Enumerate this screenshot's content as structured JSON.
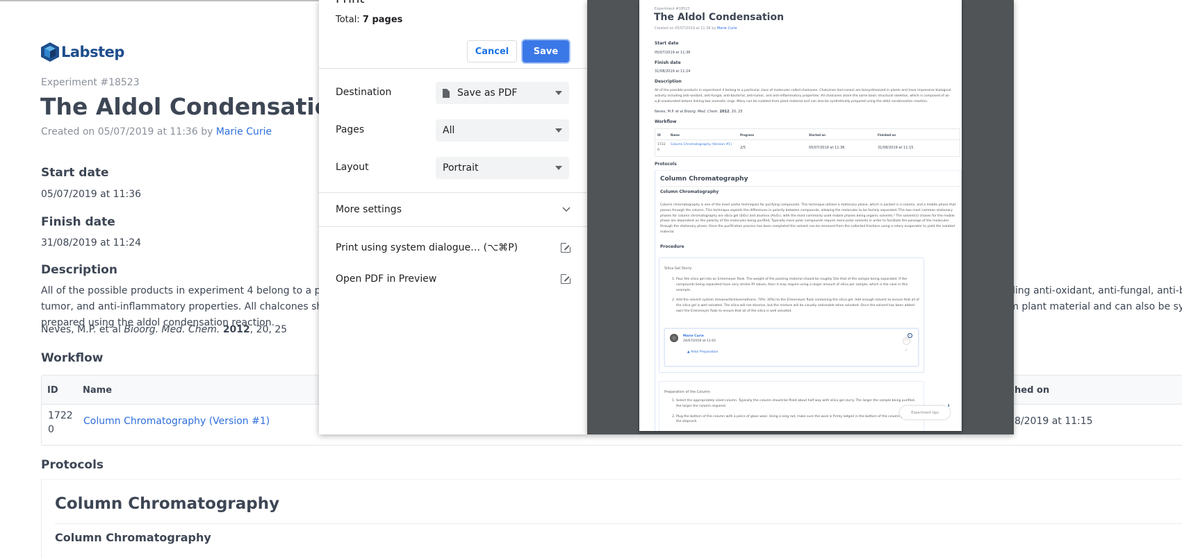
{
  "experiment": {
    "brand": "Labstep",
    "number": "Experiment #18523",
    "title": "The Aldol Condensation",
    "created_prefix": "Created on 05/07/2019 at 11:36 by",
    "author": "Marie Curie",
    "start_label": "Start date",
    "start_value": "05/07/2019 at 11:36",
    "finish_label": "Finish date",
    "finish_value": "31/08/2019 at 11:24",
    "description_label": "Description",
    "description": "All of the possible products in experiment 4 belong to a particular class of molecules called chalcones. Chalcones (kal-cones) are biosynthesized in plants and have impressive biological activity including anti-oxidant, anti-fungal, anti-bacterial, anti-tumor, and anti-inflammatory properties. All chalcones share the same basic structural skeleton, which is composed of an α,β-unsaturated ketone linking two aromatic rings. Many can be isolated from plant material and can also be synthetically prepared using the aldol condensation reaction.",
    "ref_authors": "Neves, M.P. et al",
    "ref_journal": "Bioorg. Med. Chem.",
    "ref_year": "2012",
    "ref_rest": ", 20, 25",
    "workflow_label": "Workflow",
    "workflow": {
      "columns": [
        "ID",
        "Name",
        "Progress",
        "Started on",
        "Finished on"
      ],
      "visible_finished_header": "hed on",
      "rows": [
        {
          "id": "1722 0",
          "name": "Column Chromatography (Version #1)",
          "progress": "2/5",
          "started": "05/07/2019 at 11:36",
          "finished": "31/08/2019 at 11:15",
          "visible_finished": "8/2019 at 11:15"
        }
      ]
    },
    "protocols_label": "Protocols",
    "protocol_title": "Column Chromatography",
    "protocol_subtitle": "Column Chromatography",
    "protocol_text": "Column chromatography is one of the most useful techniques for purifying compounds. This technique utilizes a stationary phase, which is packed in a column, and a mobile phase that passes through the column. This technique exploits the differences in polarity between compounds, allowing the molecules to be facilely separated.¹The two most common stationary phases for column chromatography are silica gel (SiO₂) and alumina (Al₂O₃), with the most commonly used mobile phases being organic solvents.² The solvent(s) chosen for the mobile phase are dependent on the polarity of the molecules being purified. Typically more polar compounds require more polar solvents in order to facilitate the passage of the molecules through the stationary phase. Once the purification process has been completed the solvent can be removed from the collected fractions using a rotary evaporator to yield the isolated material.",
    "procedure_label": "Procedure",
    "steps": [
      {
        "title": "Silica Gel Slurry",
        "items": [
          "Pour the silica gel into an Erlenmeyer flask. The weight of the packing material should be roughly 50x that of the sample being separated. If the compounds being separated have very similar Rf values, then it may require using a larger amount of silica per sample, which is the case in this example.",
          "Add the solvent system (hexane/dichloromethane, 70%: 30%) to the Erlenmeyer flask containing the silica gel. Add enough solvent to ensure that all of the silica gel is well solvated. The silica will not dissolve, but the mixture will be visually noticeable when solvated. Once the solvent has been added swirl the Erlenmeyer flask to ensure that all of the silica is well solvated."
        ]
      },
      {
        "title": "Preparation of the Column",
        "items": [
          "Select the appropriately sized column. Typically the column should be filled about half way with silica gel slurry. The larger the sample being purified, the larger the column required.",
          "Plug the bottom of the column with a piece of glass wool. Using a long rod, make sure the wool is firmly lodged in the bottom of the column just above the stopcock."
        ]
      }
    ],
    "comment": {
      "author": "Marie Curie",
      "date": "24/07/2019 at 11:01",
      "link": "Aldol Preparation",
      "badge": "1"
    },
    "tips_label": "Experiment tips",
    "tips_badge": "3"
  },
  "print_dialog": {
    "title": "Print",
    "total_prefix": "Total:",
    "total_value": "7 pages",
    "cancel": "Cancel",
    "save": "Save",
    "destination_label": "Destination",
    "destination_value": "Save as PDF",
    "pages_label": "Pages",
    "pages_value": "All",
    "layout_label": "Layout",
    "layout_value": "Portrait",
    "more_settings": "More settings",
    "system_dialogue": "Print using system dialogue… (⌥⌘P)",
    "open_pdf": "Open PDF in Preview"
  },
  "colors": {
    "accent": "#3b78e7",
    "link": "#2f6fdd",
    "preview_bg": "#505457",
    "text": "#3d4654",
    "brand": "#1e4e8c"
  }
}
